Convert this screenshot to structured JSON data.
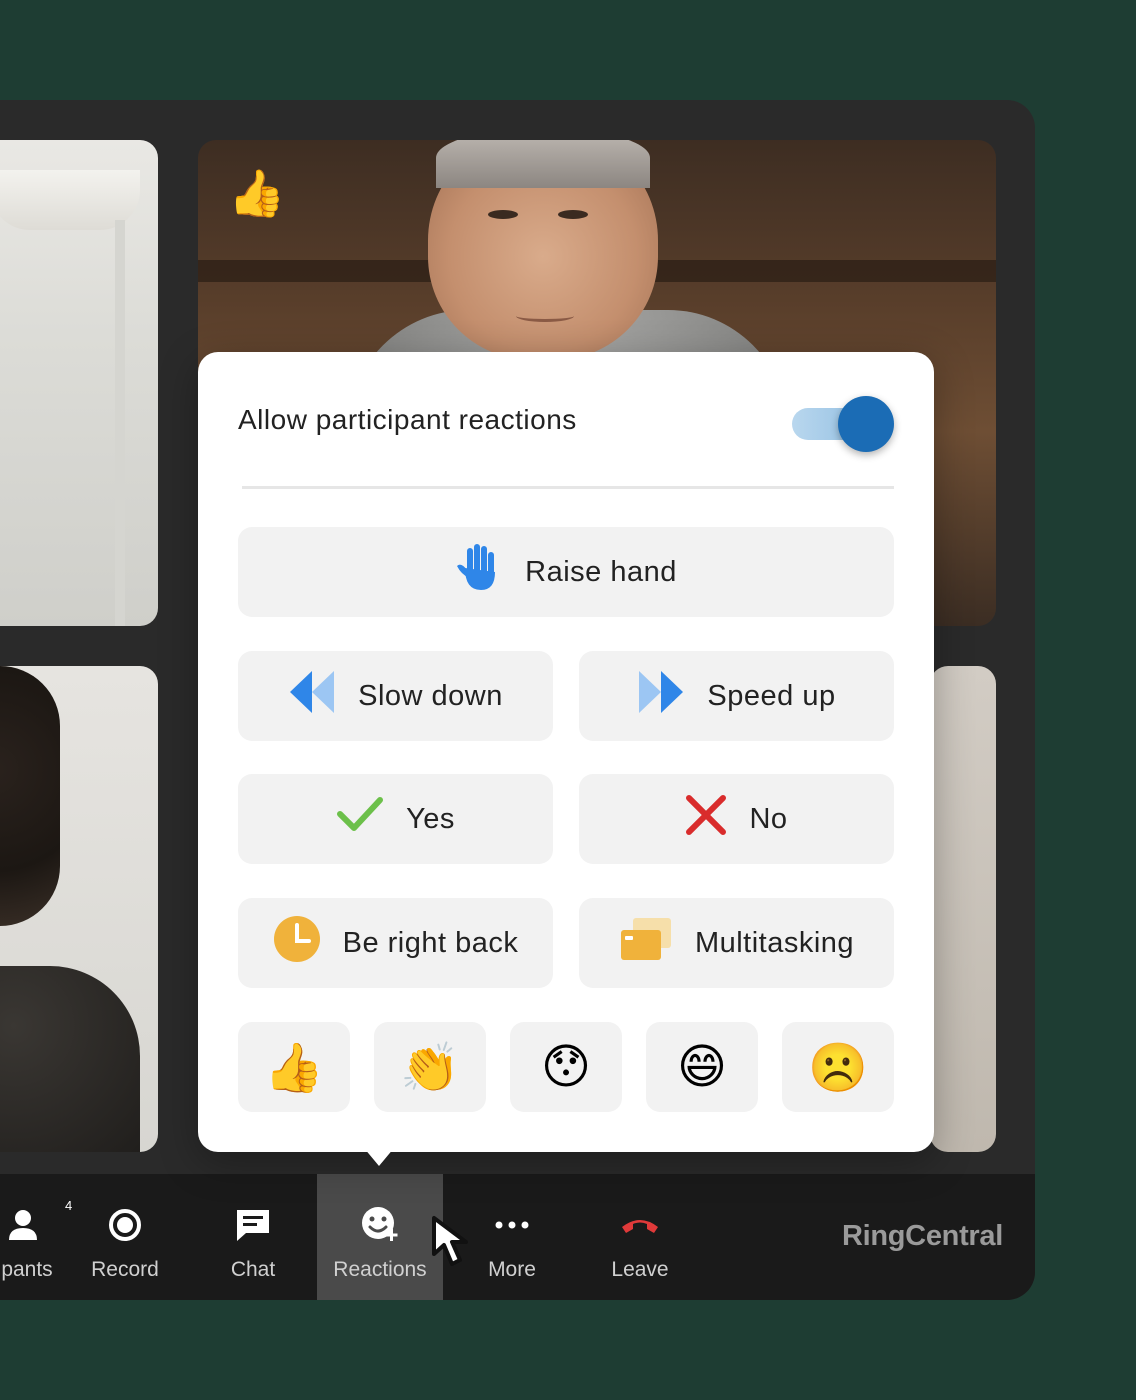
{
  "popover": {
    "title": "Allow participant reactions",
    "toggle_on": true,
    "buttons": {
      "raise_hand": "Raise hand",
      "slow_down": "Slow down",
      "speed_up": "Speed up",
      "yes": "Yes",
      "no": "No",
      "be_right_back": "Be right back",
      "multitasking": "Multitasking"
    },
    "emojis": [
      "👍",
      "👏",
      "😯",
      "😄",
      "☹️"
    ]
  },
  "tile_reaction": "👍",
  "toolbar": {
    "participants": "pants",
    "participants_count": "4",
    "record": "Record",
    "chat": "Chat",
    "reactions": "Reactions",
    "more": "More",
    "leave": "Leave",
    "brand": "RingCentral"
  },
  "colors": {
    "background": "#1e3d33",
    "accent": "#1b6cb5",
    "leave": "#e03a3a",
    "check": "#6cc04a",
    "cross": "#d92c2c",
    "clock": "#f0b23b"
  }
}
